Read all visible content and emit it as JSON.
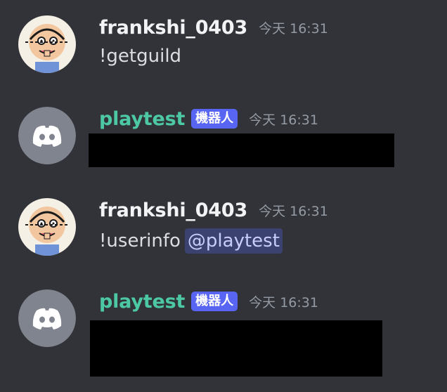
{
  "messages": [
    {
      "username": "frankshi_0403",
      "timestamp": "今天 16:31",
      "text": "!getguild",
      "avatar": "cartoon-face-avatar"
    },
    {
      "username": "playtest",
      "bot_tag": "機器人",
      "timestamp": "今天 16:31",
      "avatar": "discord-logo-avatar",
      "content": "redacted"
    },
    {
      "username": "frankshi_0403",
      "timestamp": "今天 16:31",
      "text": "!userinfo",
      "mention": "@playtest",
      "avatar": "cartoon-face-avatar"
    },
    {
      "username": "playtest",
      "bot_tag": "機器人",
      "timestamp": "今天 16:31",
      "avatar": "discord-logo-avatar",
      "content": "redacted"
    }
  ],
  "colors": {
    "background": "#313338",
    "bot_username": "#4cc9a4",
    "bot_tag": "#5865f2",
    "mention_bg": "#3c4270",
    "mention_text": "#c9cdfb"
  }
}
